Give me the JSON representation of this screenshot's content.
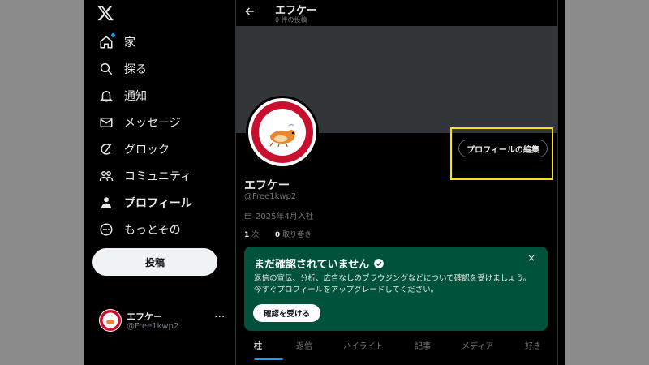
{
  "sidebar": {
    "logo": "x-logo",
    "items": [
      {
        "label": "家",
        "icon": "home-icon",
        "active": false
      },
      {
        "label": "探る",
        "icon": "search-icon",
        "active": false
      },
      {
        "label": "通知",
        "icon": "bell-icon",
        "active": false
      },
      {
        "label": "メッセージ",
        "icon": "mail-icon",
        "active": false
      },
      {
        "label": "グロック",
        "icon": "grok-icon",
        "active": false
      },
      {
        "label": "コミュニティ",
        "icon": "community-icon",
        "active": false
      },
      {
        "label": "プロフィール",
        "icon": "person-icon",
        "active": true
      },
      {
        "label": "もっとその",
        "icon": "more-icon",
        "active": false
      }
    ],
    "post_label": "投稿"
  },
  "account": {
    "name": "エフケー",
    "handle": "@Free1kwp2",
    "more": "···"
  },
  "header": {
    "name": "エフケー",
    "post_count": "0 件の投稿"
  },
  "profile": {
    "edit_label": "プロフィールの編集",
    "name": "エフケー",
    "handle": "@Free1kwp2",
    "joined": "2025年4月入社",
    "following_count": "1",
    "following_label": "次",
    "followers_count": "0",
    "followers_label": "取り巻き"
  },
  "verify_card": {
    "title": "まだ確認されていません",
    "text": "返信の宣伝、分析、広告なしのブラウジングなどについて確認を受けましょう。今すぐプロフィールをアップグレードしてください。",
    "button_label": "確認を受ける",
    "close": "×"
  },
  "tabs": [
    {
      "label": "柱",
      "active": true
    },
    {
      "label": "返信",
      "active": false
    },
    {
      "label": "ハイライト",
      "active": false
    },
    {
      "label": "記事",
      "active": false
    },
    {
      "label": "メディア",
      "active": false
    },
    {
      "label": "好き",
      "active": false
    }
  ],
  "colors": {
    "accent": "#1d9bf0",
    "card_bg": "#00533a",
    "banner": "#333639",
    "highlight": "#f5e313"
  }
}
